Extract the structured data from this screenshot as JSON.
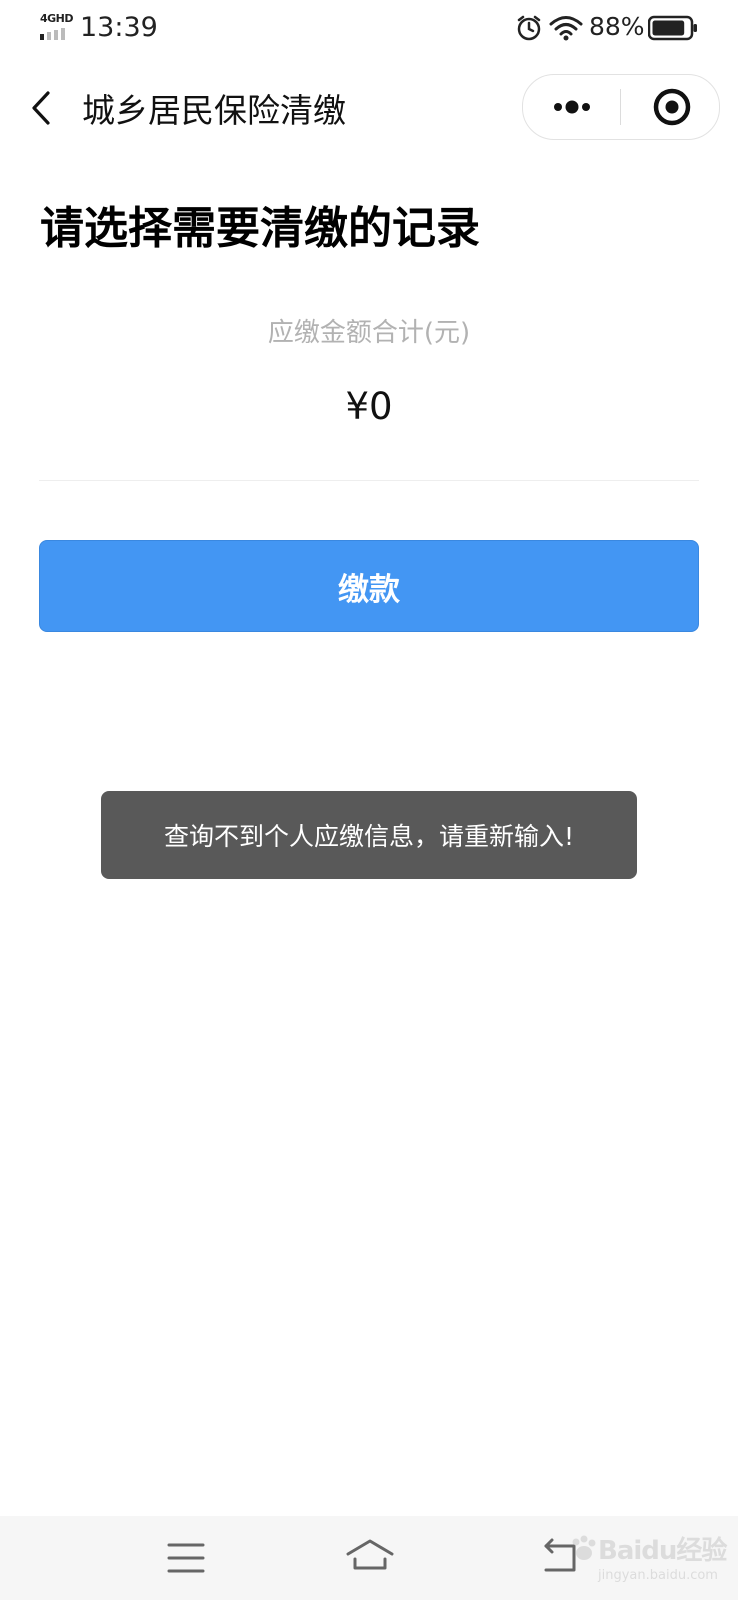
{
  "status_bar": {
    "network": "4GHD",
    "time": "13:39",
    "battery_percent": "88%",
    "battery_level": 0.88
  },
  "nav": {
    "title": "城乡居民保险清缴"
  },
  "main": {
    "heading": "请选择需要清缴的记录",
    "amount_label": "应缴金额合计(元)",
    "amount_value": "¥0",
    "pay_button_label": "缴款"
  },
  "toast": {
    "message": "查询不到个人应缴信息，请重新输入!"
  },
  "watermark": {
    "text": "Baidu经验",
    "subtext": "jingyan.baidu.com"
  },
  "colors": {
    "primary_button": "#4396f3",
    "toast_background": "#595959",
    "muted_text": "#b2b2b2"
  }
}
